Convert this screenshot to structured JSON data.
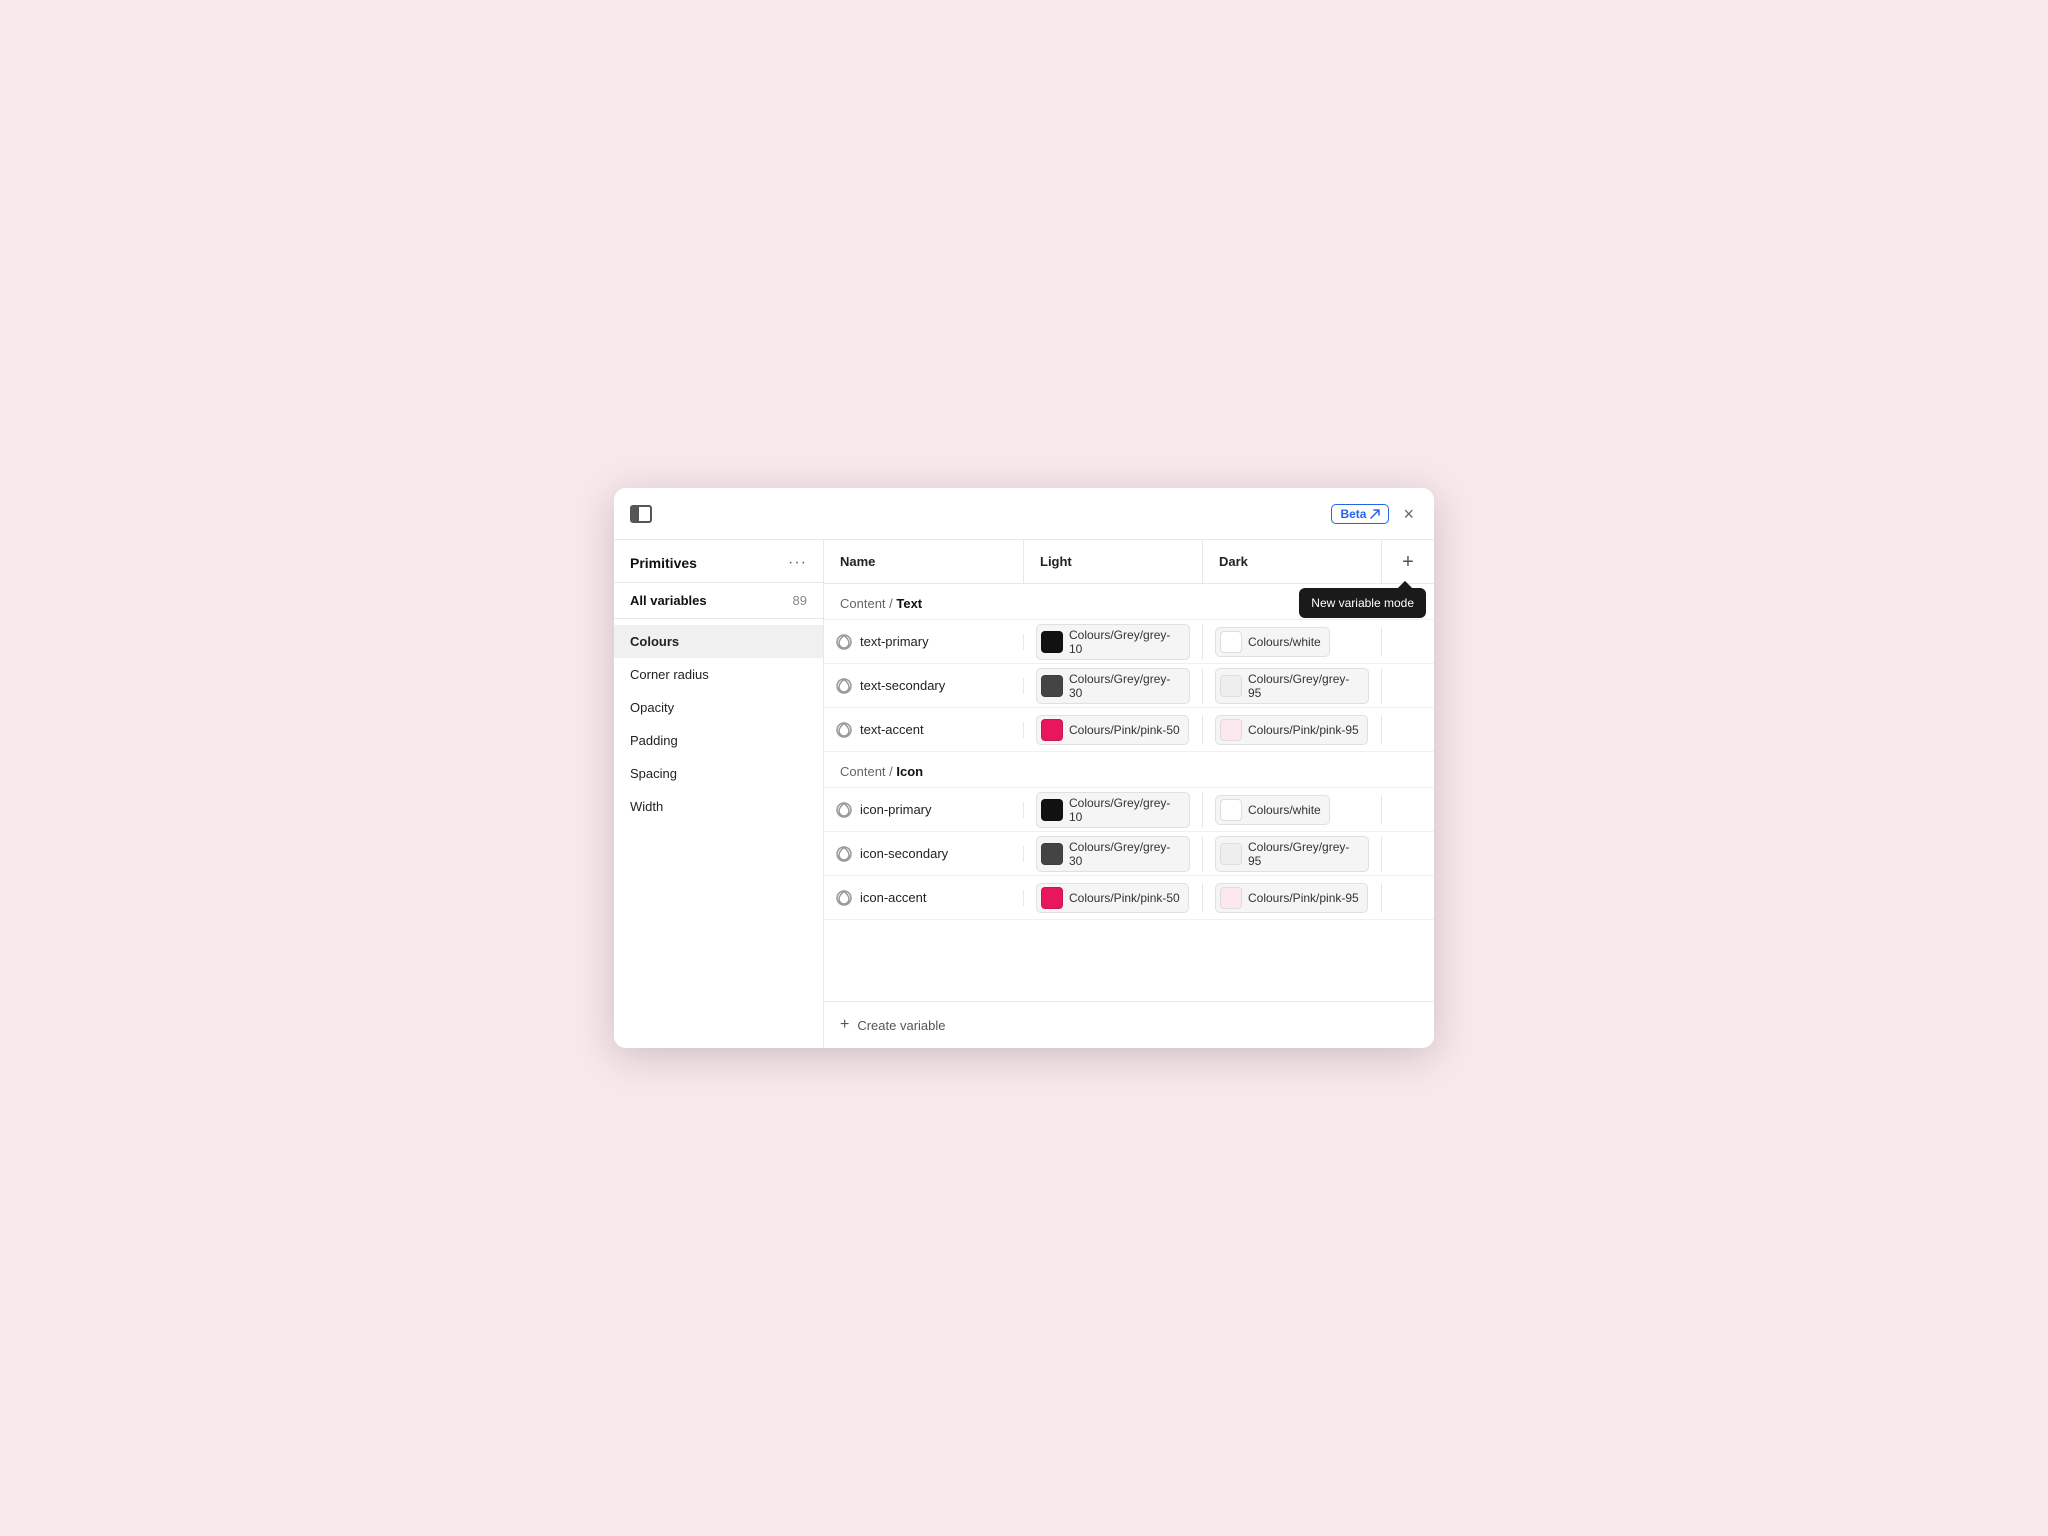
{
  "window": {
    "title": "Primitives",
    "beta_label": "Beta",
    "close_label": "×",
    "more_options": "···"
  },
  "sidebar": {
    "title": "Primitives",
    "all_variables_label": "All variables",
    "all_variables_count": "89",
    "nav_items": [
      {
        "id": "colours",
        "label": "Colours",
        "active": true
      },
      {
        "id": "corner-radius",
        "label": "Corner radius",
        "active": false
      },
      {
        "id": "opacity",
        "label": "Opacity",
        "active": false
      },
      {
        "id": "padding",
        "label": "Padding",
        "active": false
      },
      {
        "id": "spacing",
        "label": "Spacing",
        "active": false
      },
      {
        "id": "width",
        "label": "Width",
        "active": false
      }
    ]
  },
  "table": {
    "col_name": "Name",
    "col_light": "Light",
    "col_dark": "Dark",
    "add_mode_label": "+",
    "tooltip": "New variable mode",
    "sections": [
      {
        "id": "content-text",
        "prefix": "Content / ",
        "bold": "Text",
        "rows": [
          {
            "name": "text-primary",
            "light_color": "#111111",
            "light_label": "Colours/Grey/grey-10",
            "dark_color": "#ffffff",
            "dark_label": "Colours/white",
            "dark_swatch_style": "border: 1px solid #ccc;"
          },
          {
            "name": "text-secondary",
            "light_color": "#444444",
            "light_label": "Colours/Grey/grey-30",
            "dark_color": "#f0eded",
            "dark_label": "Colours/Grey/grey-95",
            "dark_swatch_style": ""
          },
          {
            "name": "text-accent",
            "light_color": "#e8175d",
            "light_label": "Colours/Pink/pink-50",
            "dark_color": "#fce8ef",
            "dark_label": "Colours/Pink/pink-95",
            "dark_swatch_style": ""
          }
        ]
      },
      {
        "id": "content-icon",
        "prefix": "Content / ",
        "bold": "Icon",
        "rows": [
          {
            "name": "icon-primary",
            "light_color": "#111111",
            "light_label": "Colours/Grey/grey-10",
            "dark_color": "#ffffff",
            "dark_label": "Colours/white",
            "dark_swatch_style": "border: 1px solid #ccc;"
          },
          {
            "name": "icon-secondary",
            "light_color": "#444444",
            "light_label": "Colours/Grey/grey-30",
            "dark_color": "#f0eded",
            "dark_label": "Colours/Grey/grey-95",
            "dark_swatch_style": ""
          },
          {
            "name": "icon-accent",
            "light_color": "#e8175d",
            "light_label": "Colours/Pink/pink-50",
            "dark_color": "#fce8ef",
            "dark_label": "Colours/Pink/pink-95",
            "dark_swatch_style": ""
          }
        ]
      }
    ],
    "create_variable_label": "Create variable"
  }
}
